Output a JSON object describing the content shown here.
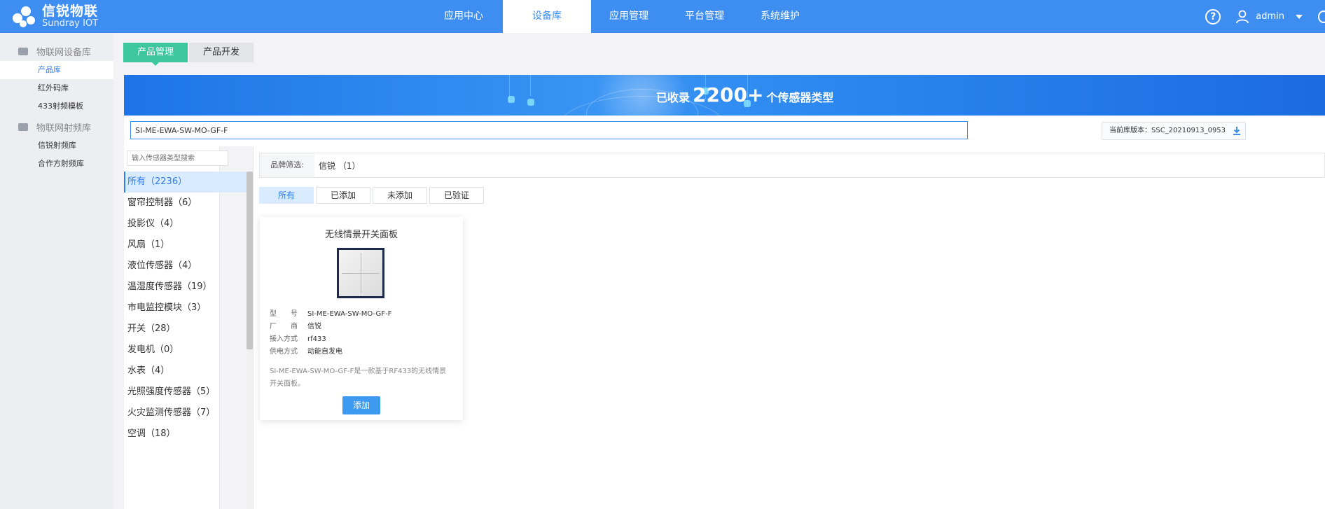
{
  "header": {
    "brand_cn": "信锐物联",
    "brand_en": "Sundray IOT",
    "nav": [
      {
        "label": "应用中心"
      },
      {
        "label": "设备库",
        "active": true
      },
      {
        "label": "应用管理"
      },
      {
        "label": "平台管理"
      },
      {
        "label": "系统维护"
      }
    ],
    "help_glyph": "?",
    "user": "admin",
    "icons": [
      "help-icon",
      "user-icon",
      "chevron-down-icon",
      "power-icon"
    ],
    "accent_color": "#3d8ef0"
  },
  "sidebar": {
    "groups": [
      {
        "label": "物联网设备库",
        "items": [
          {
            "label": "产品库",
            "active": true
          },
          {
            "label": "红外码库"
          },
          {
            "label": "433射频模板"
          }
        ]
      },
      {
        "label": "物联网射频库",
        "items": [
          {
            "label": "信锐射频库"
          },
          {
            "label": "合作方射频库"
          }
        ]
      }
    ]
  },
  "subtabs": [
    {
      "label": "产品管理",
      "active": true
    },
    {
      "label": "产品开发"
    }
  ],
  "banner": {
    "prefix": "已收录",
    "count": "2200+",
    "suffix": "个传感器类型"
  },
  "search": {
    "value": "SI-ME-EWA-SW-MO-GF-F",
    "version_text": "当前库版本：SSC_20210913_0953"
  },
  "categories": {
    "search_placeholder": "输入传感器类型搜索",
    "items": [
      {
        "label": "所有（2236）",
        "active": true
      },
      {
        "label": "窗帘控制器（6）"
      },
      {
        "label": "投影仪（4）"
      },
      {
        "label": "风扇（1）"
      },
      {
        "label": "液位传感器（4）"
      },
      {
        "label": "温湿度传感器（19）"
      },
      {
        "label": "市电监控模块（3）"
      },
      {
        "label": "开关（28）"
      },
      {
        "label": "发电机（0）"
      },
      {
        "label": "水表（4）"
      },
      {
        "label": "光照强度传感器（5）"
      },
      {
        "label": "火灾监测传感器（7）"
      },
      {
        "label": "空调（18）"
      }
    ]
  },
  "filters": {
    "brand_label": "品牌筛选:",
    "brand_value": "信锐 （1）",
    "tabs": [
      {
        "label": "所有",
        "active": true
      },
      {
        "label": "已添加"
      },
      {
        "label": "未添加"
      },
      {
        "label": "已验证"
      }
    ]
  },
  "card": {
    "title": "无线情景开关面板",
    "specs": [
      {
        "k": "型　　号",
        "v": "SI-ME-EWA-SW-MO-GF-F"
      },
      {
        "k": "厂　　商",
        "v": "信锐"
      },
      {
        "k": "接入方式",
        "v": "rf433"
      },
      {
        "k": "供电方式",
        "v": "动能自发电"
      }
    ],
    "description": "SI-ME-EWA-SW-MO-GF-F是一款基于RF433的无线情景开关面板。",
    "add_label": "添加"
  }
}
